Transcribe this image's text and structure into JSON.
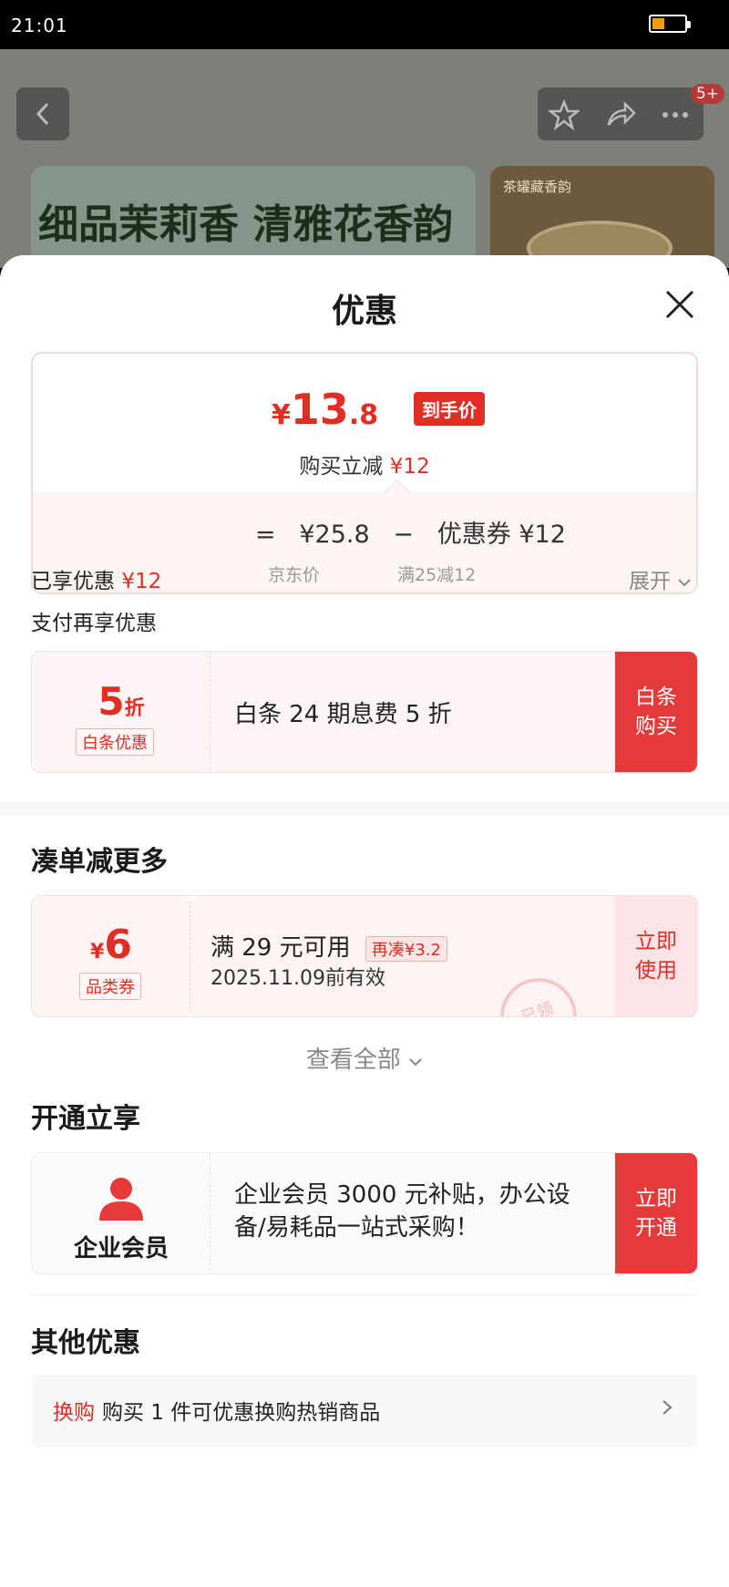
{
  "status_bar": {
    "time": "21:01"
  },
  "background": {
    "notification_badge": "5+",
    "banner_text": "细品茉莉香 清雅花香韵",
    "thumb_text": "茶罐藏香韵"
  },
  "sheet": {
    "title": "优惠",
    "price_card": {
      "currency": "¥",
      "price_int": "13",
      "price_dec": ".8",
      "price_tag": "到手价",
      "reduce_prefix": "购买立减",
      "reduce_amount": "¥12",
      "calc": {
        "equals": "=",
        "base_price": "¥25.8",
        "minus": "−",
        "coupon_label": "优惠券 ¥12",
        "base_price_sub": "京东价",
        "coupon_sub": "满25减12"
      }
    },
    "enjoyed": {
      "label": "已享优惠",
      "amount": "¥12",
      "expand": "展开"
    },
    "pay_section": {
      "title": "支付再享优惠",
      "card": {
        "value": "5",
        "unit": "折",
        "chip": "白条优惠",
        "desc": "白条 24 期息费 5 折",
        "btn_line1": "白条",
        "btn_line2": "购买"
      }
    },
    "bundle_section": {
      "title": "凑单减更多",
      "coupon": {
        "currency": "¥",
        "value": "6",
        "chip": "品类券",
        "condition": "满 29 元可用",
        "more_tag": "再凑¥3.2",
        "valid": "2025.11.09前有效",
        "stamp": "已领",
        "btn_line1": "立即",
        "btn_line2": "使用"
      },
      "view_all": "查看全部"
    },
    "open_section": {
      "title": "开通立享",
      "member": {
        "label": "企业会员",
        "desc": "企业会员 3000 元补贴，办公设备/易耗品一站式采购！",
        "btn_line1": "立即",
        "btn_line2": "开通"
      }
    },
    "other_section": {
      "title": "其他优惠",
      "row": {
        "tag": "换购",
        "text": "购买 1 件可优惠换购热销商品"
      }
    }
  },
  "colors": {
    "accent": "#e02e24",
    "button_red": "#e6393a",
    "soft_pink": "#fdf3f3"
  }
}
